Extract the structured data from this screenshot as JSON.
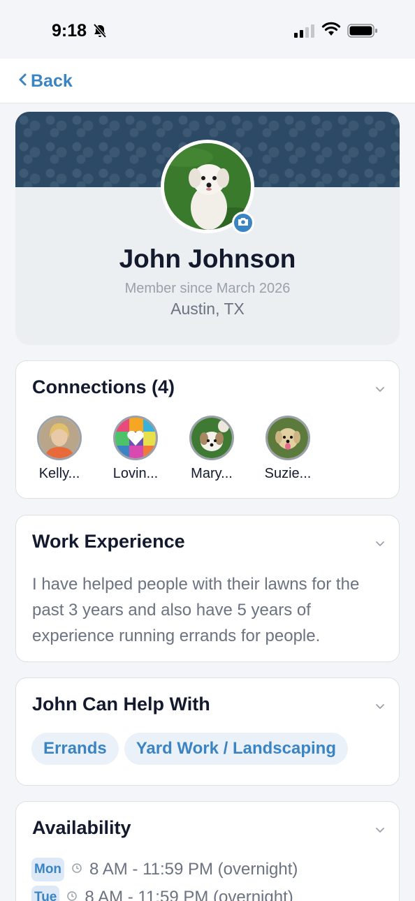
{
  "status_bar": {
    "time": "9:18"
  },
  "nav": {
    "back_label": "Back"
  },
  "profile": {
    "name": "John Johnson",
    "member_since": "Member since March 2026",
    "location": "Austin, TX"
  },
  "connections": {
    "title": "Connections (4)",
    "items": [
      {
        "name": "Kelly..."
      },
      {
        "name": "Lovin..."
      },
      {
        "name": "Mary..."
      },
      {
        "name": "Suzie..."
      }
    ]
  },
  "work_experience": {
    "title": "Work Experience",
    "text": "I have helped people with their lawns for the past 3 years and also have 5 years of experience running errands for people."
  },
  "help_with": {
    "title": "John Can Help With",
    "chips": [
      "Errands",
      "Yard Work / Landscaping"
    ]
  },
  "availability": {
    "title": "Availability",
    "rows": [
      {
        "day": "Mon",
        "time": "8 AM - 11:59 PM (overnight)"
      },
      {
        "day": "Tue",
        "time": "8 AM - 11:59 PM (overnight)"
      }
    ]
  },
  "colors": {
    "accent": "#3b84c4",
    "banner": "#2c4a66",
    "background": "#f3f5f8",
    "text_dark": "#141a2e",
    "text_muted": "#6b7280"
  }
}
